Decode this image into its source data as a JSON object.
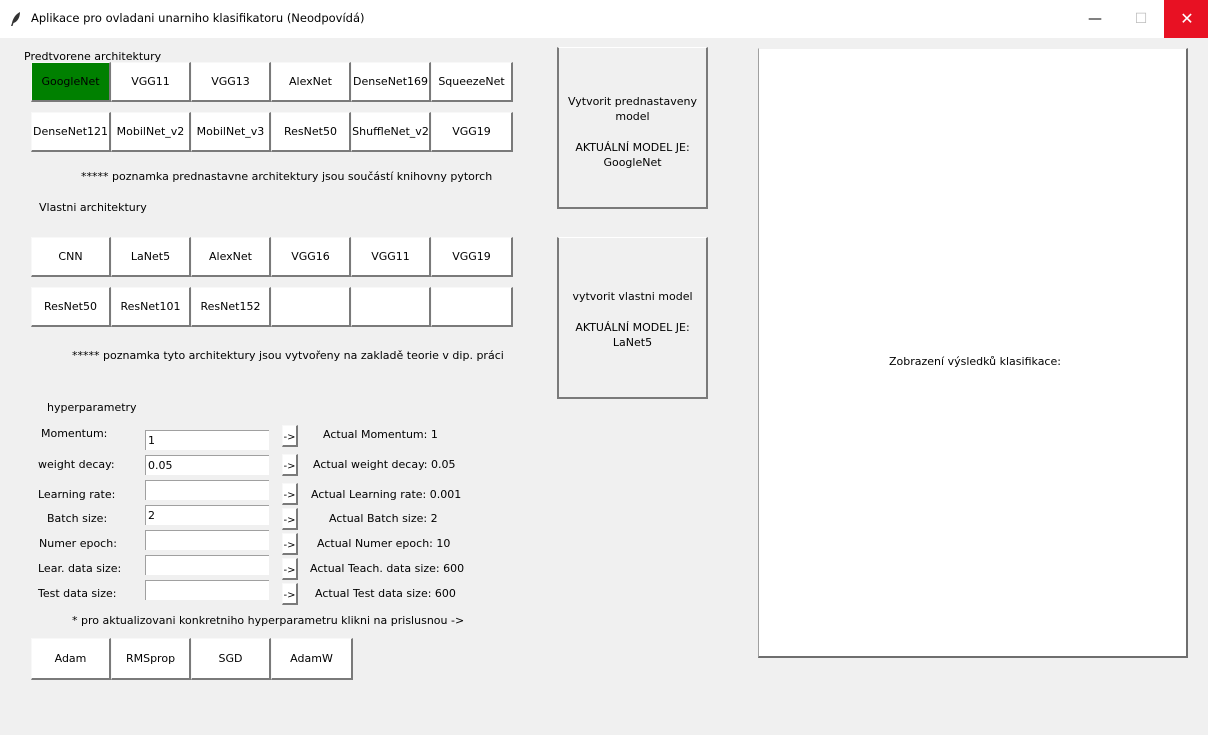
{
  "window": {
    "title": "Aplikace pro ovladani unarniho klasifikatoru (Neodpovídá)",
    "minimize": "—",
    "maximize": "☐",
    "close": "✕"
  },
  "predefined": {
    "heading": "Predtvorene architektury",
    "row1": [
      "GoogleNet",
      "VGG11",
      "VGG13",
      "AlexNet",
      "DenseNet169",
      "SqueezeNet"
    ],
    "row2": [
      "DenseNet121",
      "MobilNet_v2",
      "MobilNet_v3",
      "ResNet50",
      "ShuffleNet_v2",
      "VGG19"
    ],
    "selected": "GoogleNet",
    "selected_color": "#008000",
    "note": "***** poznamka prednastavne architektury jsou součástí knihovny pytorch"
  },
  "custom": {
    "heading": "Vlastni architektury",
    "row1": [
      "CNN",
      "LaNet5",
      "AlexNet",
      "VGG16",
      "VGG11",
      "VGG19"
    ],
    "row2": [
      "ResNet50",
      "ResNet101",
      "ResNet152",
      "",
      "",
      ""
    ],
    "note": "***** poznamka tyto architektury jsou vytvořeny na zakladě teorie v dip. práci"
  },
  "hyper": {
    "heading": "hyperparametry",
    "arrow": "->",
    "rows": [
      {
        "label": "Momentum:",
        "value": "1",
        "actual": "Actual Momentum: 1"
      },
      {
        "label": "weight decay:",
        "value": "0.05",
        "actual": "Actual weight decay: 0.05"
      },
      {
        "label": "Learning rate:",
        "value": "",
        "actual": "Actual Learning rate: 0.001"
      },
      {
        "label": "Batch size:",
        "value": "2",
        "actual": "Actual Batch size: 2"
      },
      {
        "label": "Numer epoch:",
        "value": "",
        "actual": "Actual Numer epoch: 10"
      },
      {
        "label": "Lear. data size:",
        "value": "",
        "actual": "Actual Teach. data size: 600"
      },
      {
        "label": "Test data size:",
        "value": "",
        "actual": "Actual Test data size: 600"
      }
    ],
    "hint": "* pro aktualizovani konkretniho hyperparametru klikni na prislusnou ->"
  },
  "optimizers": [
    "Adam",
    "RMSprop",
    "SGD",
    "AdamW"
  ],
  "create_predefined": {
    "line1": "Vytvorit prednastaveny",
    "line2": "model",
    "line3": "AKTUÁLNÍ MODEL JE:",
    "line4": "GoogleNet"
  },
  "create_custom": {
    "line1": "vytvorit vlastni model",
    "line3": "AKTUÁLNÍ MODEL JE:",
    "line4": "LaNet5"
  },
  "results": {
    "label": "Zobrazení výsledků klasifikace:"
  }
}
